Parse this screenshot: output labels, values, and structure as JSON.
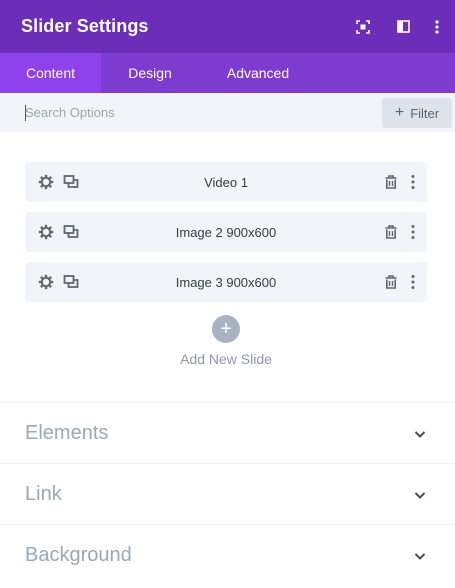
{
  "header": {
    "title": "Slider Settings",
    "icons": [
      "expand-icon",
      "split-view-icon",
      "more-vertical-icon"
    ],
    "background": "#6c2eb9"
  },
  "tabs": [
    {
      "label": "Content",
      "active": true
    },
    {
      "label": "Design",
      "active": false
    },
    {
      "label": "Advanced",
      "active": false
    }
  ],
  "search": {
    "placeholder": "Search Options",
    "value": "",
    "filter_label": "Filter"
  },
  "slides": [
    {
      "label": "Video 1"
    },
    {
      "label": "Image 2 900x600"
    },
    {
      "label": "Image 3 900x600"
    }
  ],
  "add_slide": {
    "label": "Add New Slide"
  },
  "sections": [
    {
      "title": "Elements"
    },
    {
      "title": "Link"
    },
    {
      "title": "Background"
    }
  ],
  "colors": {
    "tab_bar": "#7e3bd0",
    "active_tab": "#8f42ec",
    "row_bg": "#f1f5f9"
  }
}
